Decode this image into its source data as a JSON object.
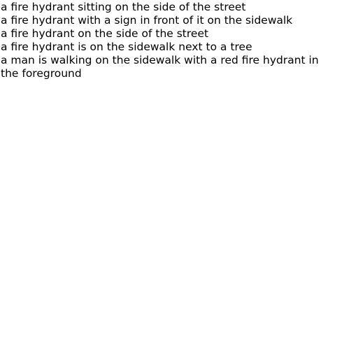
{
  "captions": [
    "a fire hydrant sitting on the side of the street",
    "a fire hydrant with a sign in front of it on the sidewalk",
    "a fire hydrant on the side of the street",
    "a fire hydrant is on the sidewalk next to a tree",
    "a man is walking on the sidewalk with a red fire hydrant in the foreground"
  ]
}
